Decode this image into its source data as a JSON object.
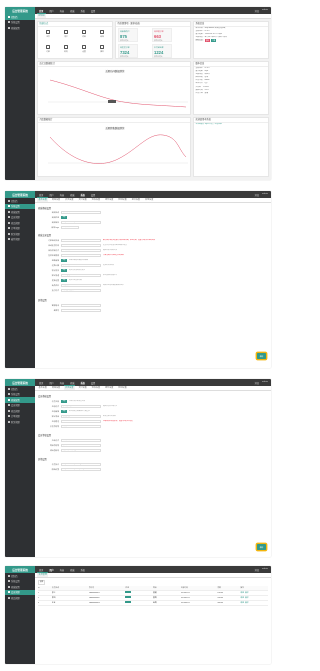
{
  "app": {
    "title": "后台管理系统"
  },
  "topnav": [
    "首页",
    "用户",
    "内容",
    "商城",
    "系统",
    "设置"
  ],
  "topright": [
    "消息",
    "admin"
  ],
  "sidebar": [
    "控制台",
    "系统设置",
    "商城配置",
    "会员管理",
    "商品管理",
    "订单管理",
    "财务管理",
    "插件管理"
  ],
  "s1": {
    "tab": "控制台",
    "quick_title": "快捷方式",
    "quick": [
      "主页",
      "用户",
      "内容",
      "商城",
      "订单",
      "财务",
      "设置",
      "插件"
    ],
    "stats_title": "待处理事项（更多动态）",
    "stats": [
      {
        "t": "待审核用户",
        "v": "875",
        "s": "较昨日增长"
      },
      {
        "t": "待处理订单",
        "v": "663",
        "s": "较昨日增长"
      },
      {
        "t": "待发货订单",
        "v": "7324",
        "s": "较昨日增长"
      },
      {
        "t": "本月营业额",
        "v": "1224",
        "s": "较昨日增长"
      }
    ],
    "info_title": "系统信息",
    "info": [
      "版本名称：Shop Admin 商城管理系统",
      "当前版本：v2.6.3",
      "基于框架：ThinkPHP 6.0 + Layui",
      "主要特色：零门槛 / 响应式 / 清爽 / 极简",
      "获取渠道："
    ],
    "info_buttons": [
      "官网",
      "下载"
    ],
    "chart1_panel": "近七日数据统计",
    "chart1_title": "近期访问数据趋势",
    "chart2_panel": "月度数据统计",
    "chart2_title": "近期销售数据趋势",
    "ver_title": "版本信息",
    "ver": [
      [
        "当前版本",
        "v2.6.3"
      ],
      [
        "基于框架",
        "layui"
      ],
      [
        "主要特色",
        "响应式"
      ],
      [
        "获取渠道",
        "官网"
      ],
      [
        "开发作者",
        "admin"
      ],
      [
        "联系方式",
        "QQ"
      ],
      [
        "交流群",
        "123456"
      ],
      [
        "更新时间",
        "2023"
      ],
      [
        "开发文档",
        "查看"
      ]
    ],
    "notice_title": "欢迎使用本系统",
    "notice": "本系统基于 layui 开发，欢迎体验"
  },
  "s2": {
    "tabs": [
      "基本设置",
      "商城设置",
      "会员设置",
      "支付设置",
      "短信设置",
      "邮件设置",
      "物流设置",
      "接口设置",
      "其他设置"
    ],
    "sect1": "商城基础设置",
    "sect2": "商城交易设置",
    "sect3": "其他设置",
    "rows1": [
      [
        "商城名称",
        "我的商城"
      ],
      [
        "商城状态",
        "开启"
      ],
      [
        "商城域名",
        "http://www.shop.com"
      ],
      [
        "商城Logo",
        "上传图片"
      ]
    ],
    "rows2": [
      [
        "订单自动关闭",
        "30"
      ],
      [
        "自动收货时间",
        "7"
      ],
      [
        "库存扣减方式",
        "下单扣减"
      ],
      [
        "售后申请期限",
        "7"
      ],
      [
        "退款审核",
        "开启"
      ],
      [
        "运费计算",
        "按件计算"
      ],
      [
        "积分抵扣",
        "开启"
      ],
      [
        "默认快递",
        "顺丰速运"
      ],
      [
        "发票设置",
        "开启"
      ],
      [
        "商品评价",
        "需要审核"
      ],
      [
        "支付方式",
        "微信支付 支付宝"
      ]
    ],
    "hints": [
      "未付款订单超过设定时间将自动关闭，单位分钟，设置为0表示不自动关闭",
      "发货后超过设定天数自动确认收货",
      "选择库存扣减的时机",
      "订单完成后可申请售后的天数",
      "退款申请是否需要后台审核",
      "运费的计算规则",
      "是否允许使用积分抵扣",
      "默认使用的快递公司",
      "是否开启发票功能",
      "商品评价是否需要审核后显示"
    ],
    "rows3": [
      [
        "客服电话",
        "400-000-0000"
      ],
      [
        "备案号",
        "ICP-000000"
      ]
    ],
    "save": "保存"
  },
  "s3": {
    "tabs": [
      "基本设置",
      "商城设置",
      "会员设置",
      "支付设置",
      "短信设置",
      "邮件设置",
      "物流设置"
    ],
    "sect1": "会员基础设置",
    "sect2": "会员等级设置",
    "sect3": "其他设置",
    "rows1": [
      [
        "会员注册",
        "开启"
      ],
      [
        "注册方式",
        "手机号注册"
      ],
      [
        "注册审核",
        "开启"
      ],
      [
        "默认等级",
        "普通会员"
      ],
      [
        "注册赠送",
        "100"
      ],
      [
        "会员有效期",
        "长期"
      ]
    ],
    "hints": [
      "开启后允许新会员注册",
      "选择会员的注册方式",
      "新注册会员需审核后才能登录",
      "注册成功后赠送积分，设置为0表示不赠送",
      "新会员默认的等级"
    ],
    "rows2": [
      [
        "升级方式",
        "自动升级"
      ],
      [
        "等级有效期",
        "永久"
      ],
      [
        "成长值规则",
        "消费1元=1成长值"
      ]
    ],
    "rows3": [
      [
        "会员协议",
        "http://www.shop.com/agreement"
      ],
      [
        "隐私政策",
        "http://www.shop.com/privacy"
      ]
    ],
    "save": "保存"
  },
  "s4": {
    "tab": "会员管理",
    "filter": "搜索",
    "headers": [
      "ID",
      "会员名称",
      "手机号",
      "状态",
      "等级",
      "注册时间",
      "余额",
      "操作"
    ],
    "rows": [
      [
        "1",
        "张三",
        "13800000001",
        "普通",
        "2023-01-01",
        "100.00"
      ],
      [
        "2",
        "李四",
        "13800000002",
        "银牌",
        "2023-02-01",
        "200.00"
      ],
      [
        "3",
        "王五",
        "13800000003",
        "金牌",
        "2023-03-01",
        "300.00"
      ]
    ],
    "ops": [
      "编辑",
      "删除"
    ]
  }
}
